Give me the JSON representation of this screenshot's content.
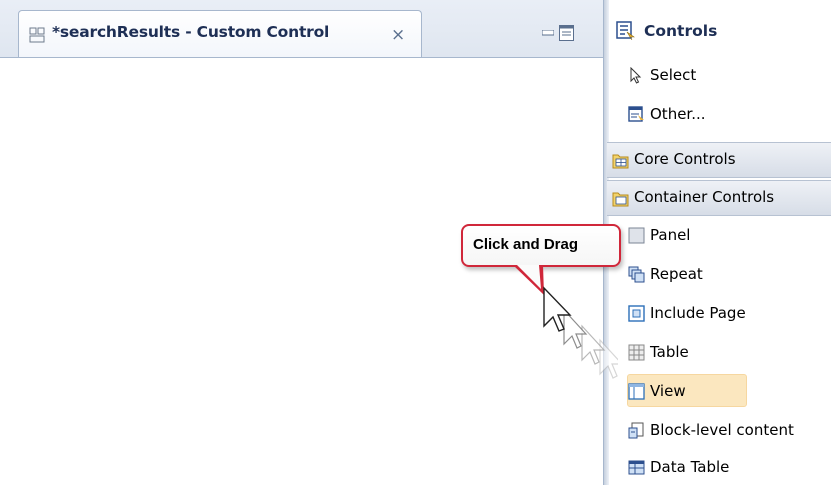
{
  "editor": {
    "tab_title": "*searchResults - Custom Control",
    "close_glyph": "×"
  },
  "palette": {
    "header": "Controls",
    "items": [
      {
        "label": "Select",
        "icon": "select-arrow-icon"
      },
      {
        "label": "Other...",
        "icon": "other-controls-icon"
      }
    ],
    "drawers": [
      {
        "label": "Core Controls",
        "icon": "folder-icon"
      },
      {
        "label": "Container Controls",
        "icon": "folder-icon"
      }
    ],
    "container_items": [
      {
        "label": "Panel",
        "icon": "panel-icon"
      },
      {
        "label": "Repeat",
        "icon": "repeat-icon"
      },
      {
        "label": "Include Page",
        "icon": "include-page-icon"
      },
      {
        "label": "Table",
        "icon": "table-icon"
      },
      {
        "label": "View",
        "icon": "view-icon",
        "selected": true
      },
      {
        "label": "Block-level content",
        "icon": "block-content-icon"
      },
      {
        "label": "Data Table",
        "icon": "data-table-icon"
      }
    ]
  },
  "callout": {
    "text": "Click and Drag"
  },
  "colors": {
    "highlight": "#fbe7bf",
    "callout_border": "#d0273a",
    "title_text": "#1e2f55"
  }
}
